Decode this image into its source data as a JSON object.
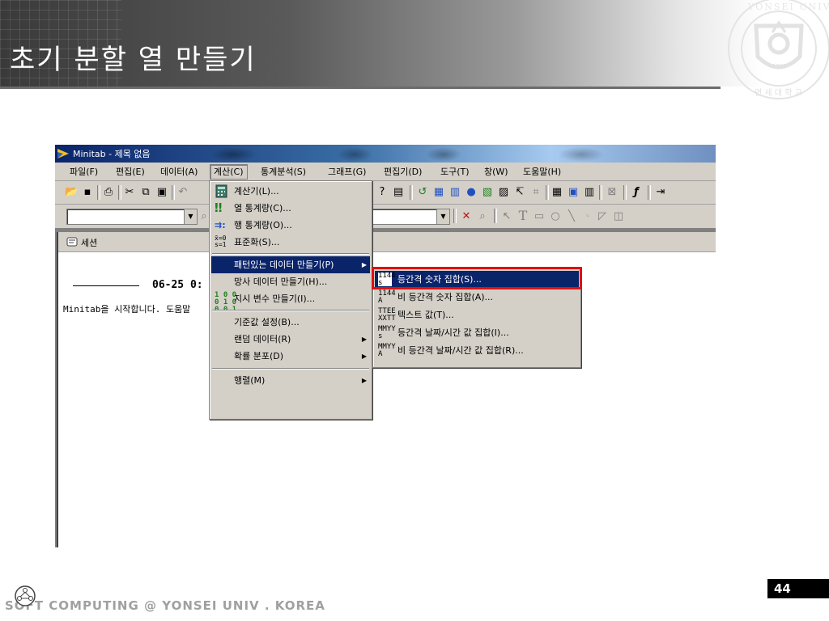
{
  "slide": {
    "title": "초기 분할 열 만들기",
    "footer_text": "SOFT COMPUTING @ YONSEI UNIV . KOREA",
    "page_number": "44",
    "emblem_text": "YONSEI UNIVERSITY",
    "emblem_year": "1885",
    "emblem_korean": "연 세 대 학 교"
  },
  "window": {
    "title": "Minitab - 제목 없음"
  },
  "menubar": {
    "items": [
      "파일(F)",
      "편집(E)",
      "데이터(A)",
      "계산(C)",
      "통계분석(S)",
      "그래프(G)",
      "편집기(D)",
      "도구(T)",
      "창(W)",
      "도움말(H)"
    ],
    "active_index": 3
  },
  "session": {
    "title": "세션",
    "date": "06-25 0:",
    "welcome": "Minitab을 시작합니다. 도움말"
  },
  "calc_menu": {
    "items": [
      {
        "label": "계산기(L)...",
        "icon": "calculator-icon"
      },
      {
        "label": "열 통계량(C)...",
        "icon": "column-stats-icon"
      },
      {
        "label": "행 통계량(O)...",
        "icon": "row-stats-icon"
      },
      {
        "label": "표준화(S)...",
        "icon": "standardize-icon"
      },
      {
        "label": "패턴있는 데이터 만들기(P)",
        "icon": "",
        "submenu": true
      },
      {
        "label": "망사 데이터 만들기(H)...",
        "icon": ""
      },
      {
        "label": "지시 변수 만들기(I)...",
        "icon": "indicator-icon"
      },
      {
        "label": "기준값 설정(B)...",
        "icon": ""
      },
      {
        "label": "랜덤 데이터(R)",
        "icon": "",
        "submenu": true
      },
      {
        "label": "확률 분포(D)",
        "icon": "",
        "submenu": true
      },
      {
        "label": "행렬(M)",
        "icon": "",
        "submenu": true
      }
    ]
  },
  "pattern_submenu": {
    "items": [
      {
        "label": "등간격 숫자 집합(S)...",
        "icon_top": "1144",
        "icon_bottom": "s"
      },
      {
        "label": "비 등간격 숫자 집합(A)...",
        "icon_top": "1144",
        "icon_bottom": "A"
      },
      {
        "label": "텍스트 값(T)...",
        "icon_top": "TTEE",
        "icon_bottom": "XXTT"
      },
      {
        "label": "등간격 날짜/시간 값 집합(I)...",
        "icon_top": "MMYY",
        "icon_bottom": "s"
      },
      {
        "label": "비 등간격 날짜/시간 값 집합(R)...",
        "icon_top": "MMYY",
        "icon_bottom": "A"
      }
    ]
  },
  "icon_glyphs": {
    "indicator": "1 0 0\n0 1 0\n0 0 1",
    "column_stats": "‼",
    "row_stats": "⇉:",
    "standardize": "x̄=0\ns=1"
  },
  "colors": {
    "title_blue": "#0a246a",
    "menu_gray": "#d4d0c8",
    "highlight_red": "#e01010"
  }
}
